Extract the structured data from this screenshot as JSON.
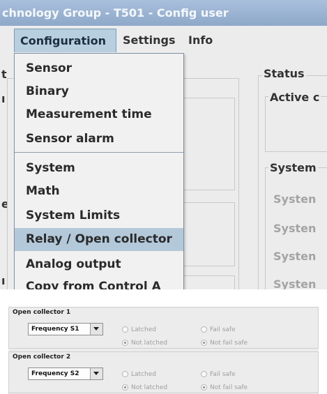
{
  "window": {
    "title": "chnology Group - T501 - Config user"
  },
  "menubar": {
    "configuration": "Configuration",
    "settings": "Settings",
    "info": "Info"
  },
  "config_menu": {
    "items": [
      {
        "label": "Sensor"
      },
      {
        "label": "Binary"
      },
      {
        "label": "Measurement time"
      },
      {
        "label": "Sensor alarm"
      },
      {
        "label": "System"
      },
      {
        "label": "Math"
      },
      {
        "label": "System Limits"
      },
      {
        "label": "Relay / Open collector",
        "highlighted": true
      },
      {
        "label": "Analog output"
      },
      {
        "label": "Copy from Control A"
      }
    ]
  },
  "background": {
    "status_title": "Status",
    "active_title": "Active c",
    "system_title": "System",
    "system_rows": [
      "Systen",
      "Systen",
      "Systen",
      "Systen"
    ]
  },
  "open_collectors": [
    {
      "title": "Open collector 1",
      "source": "Frequency S1",
      "latched_label": "Latched",
      "not_latched_label": "Not latched",
      "fail_safe_label": "Fail safe",
      "not_fail_safe_label": "Not fail safe",
      "latched": false,
      "fail_safe": false
    },
    {
      "title": "Open collector 2",
      "source": "Frequency S2",
      "latched_label": "Latched",
      "not_latched_label": "Not latched",
      "fail_safe_label": "Fail safe",
      "not_fail_safe_label": "Not fail safe",
      "latched": false,
      "fail_safe": false
    }
  ],
  "colors": {
    "titlebar": "#8ea8c9",
    "menu_highlight": "#b3c9da",
    "disabled_text": "#a4a4a4"
  }
}
